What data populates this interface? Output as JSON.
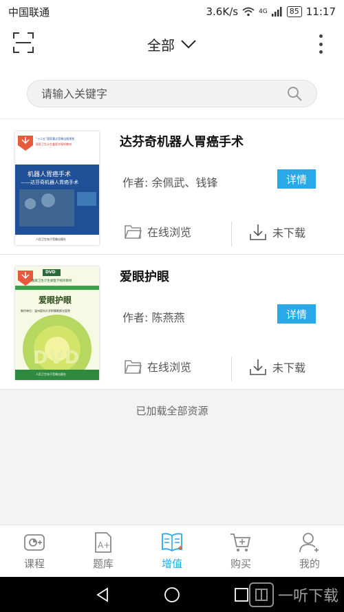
{
  "status_bar": {
    "carrier": "中国联通",
    "speed": "3.6K/s",
    "network": "4G",
    "battery": "85",
    "time": "11:17"
  },
  "header": {
    "filter_label": "全部",
    "scan_icon": "scan-icon",
    "menu_icon": "more-vertical-icon"
  },
  "search": {
    "placeholder": "请输入关键字"
  },
  "items": [
    {
      "title": "达芬奇机器人胃癌手术",
      "author": "作者: 余佩武、钱锋",
      "detail_label": "详情",
      "browse_label": "在线浏览",
      "download_label": "未下载",
      "cover": {
        "series": "“十二五”国家重点音像出版规划",
        "series2": "国家卫生计生委医学视听教材",
        "main_title": "机器人胃癌手术",
        "sub_title": "——达芬奇机器人胃癌手术",
        "publisher": "人民卫生电子音像出版社"
      }
    },
    {
      "title": "爱眼护眼",
      "author": "作者: 陈燕燕",
      "detail_label": "详情",
      "browse_label": "在线浏览",
      "download_label": "未下载",
      "cover": {
        "badge": "DVD",
        "series": "国家卫生计生委医学视听教材",
        "main_title": "爱眼护眼",
        "producer": "制作单位：温州医科大学附属眼视光医院",
        "dvd": "DVD",
        "publisher": "人民卫生电子音像出版社"
      }
    }
  ],
  "footer": {
    "loaded_text": "已加载全部资源"
  },
  "tabs": [
    {
      "label": "课程",
      "icon": "course-icon",
      "active": false
    },
    {
      "label": "题库",
      "icon": "question-bank-icon",
      "active": false
    },
    {
      "label": "增值",
      "icon": "value-added-icon",
      "active": true
    },
    {
      "label": "购买",
      "icon": "cart-icon",
      "active": false
    },
    {
      "label": "我的",
      "icon": "user-icon",
      "active": false
    }
  ],
  "colors": {
    "accent": "#2aa8e8"
  },
  "watermark": {
    "text": "一听下载"
  }
}
